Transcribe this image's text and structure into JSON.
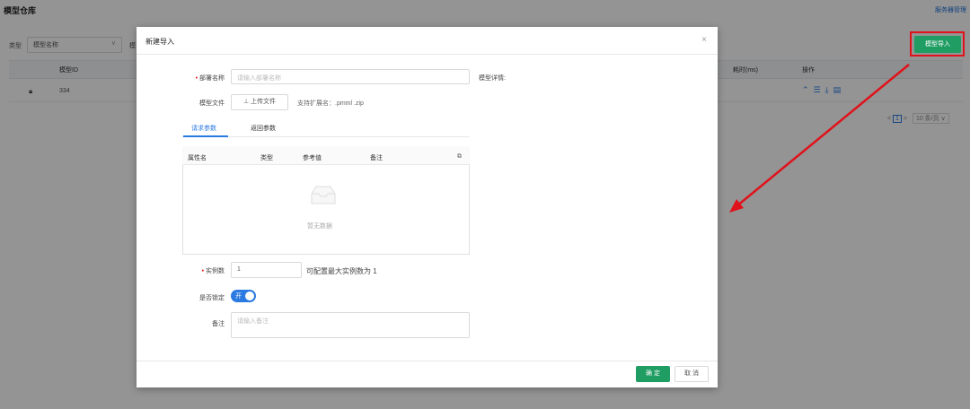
{
  "page": {
    "title": "模型仓库",
    "service_link": "服务器管理",
    "filter": {
      "label": "类型",
      "select_value": "模型名称",
      "label2": "模"
    },
    "import_button": "模型导入",
    "table": {
      "headers": {
        "id": "模型ID",
        "duration": "耗时(ms)",
        "actions": "操作"
      },
      "rows": [
        {
          "id": "334"
        }
      ]
    },
    "pager": {
      "prev": "<",
      "current": "1",
      "next": ">",
      "page_size": "10 条/页 ∨"
    }
  },
  "modal": {
    "title": "新建导入",
    "close": "×",
    "deploy_name": {
      "label": "部署名称",
      "placeholder": "请输入部署名称"
    },
    "model_detail_label": "模型详情:",
    "model_file": {
      "label": "模型文件",
      "upload_button": "上传文件",
      "hint": "支持扩展名：.pmml .zip"
    },
    "tabs": [
      {
        "label": "请求参数",
        "active": true
      },
      {
        "label": "返回参数",
        "active": false
      }
    ],
    "params_table": {
      "headers": [
        "属性名",
        "类型",
        "参考值",
        "备注"
      ],
      "empty_text": "暂无数据"
    },
    "instances": {
      "label": "实例数",
      "value": "1",
      "hint": "可配置最大实例数为 1"
    },
    "lock": {
      "label": "是否锁定",
      "toggle_text": "开",
      "on": true
    },
    "remark": {
      "label": "备注",
      "placeholder": "请输入备注"
    },
    "ok_button": "确 定",
    "cancel_button": "取 消"
  },
  "colors": {
    "primary_green": "#1f9d63",
    "accent_blue": "#2a7ae2",
    "annotation_red": "#e0121b"
  }
}
